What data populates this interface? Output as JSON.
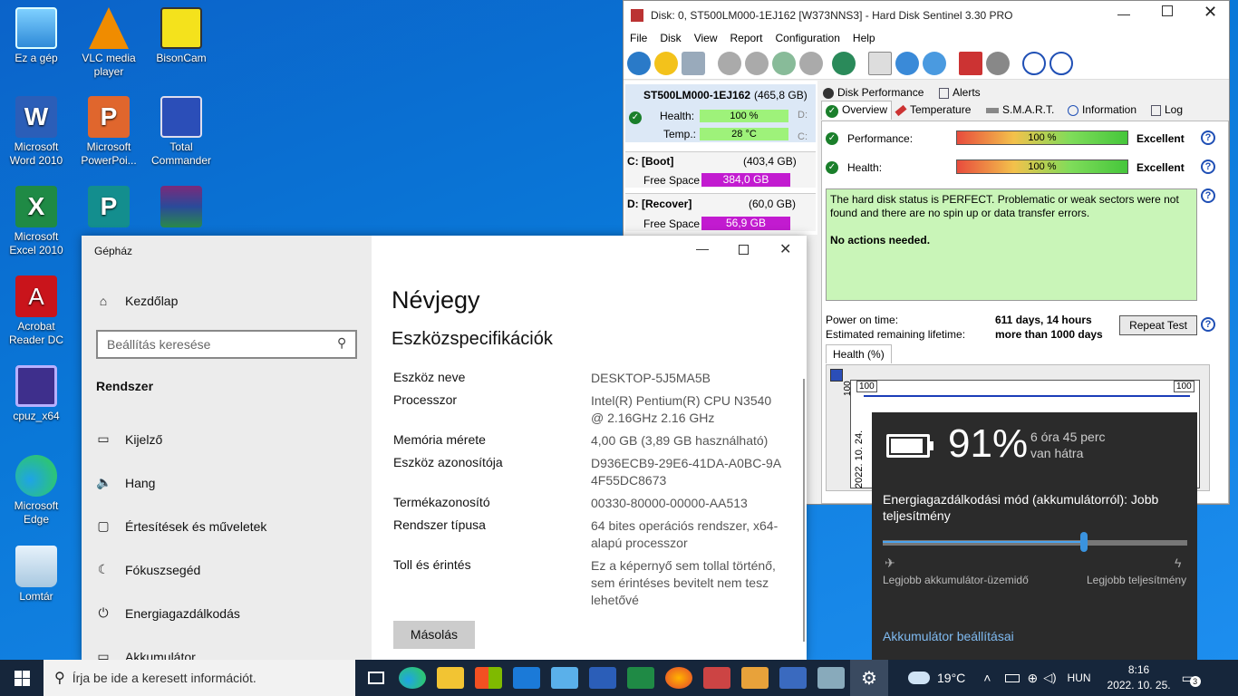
{
  "desktop": {
    "icons": [
      {
        "label": "Ez a gép",
        "icon": "computer-icon"
      },
      {
        "label": "VLC media player",
        "icon": "vlc-icon"
      },
      {
        "label": "BisonCam",
        "icon": "camera-icon"
      },
      {
        "label": "Microsoft Word 2010",
        "icon": "word-icon"
      },
      {
        "label": "Microsoft PowerPoi...",
        "icon": "powerpoint-icon"
      },
      {
        "label": "Total Commander",
        "icon": "floppy-icon"
      },
      {
        "label": "Microsoft Excel 2010",
        "icon": "excel-icon"
      },
      {
        "label": "Acrobat Reader DC",
        "icon": "acrobat-icon"
      },
      {
        "label": "cpuz_x64",
        "icon": "cpuz-icon"
      },
      {
        "label": "Microsoft Edge",
        "icon": "edge-icon"
      },
      {
        "label": "Lomtár",
        "icon": "recycle-bin-icon"
      }
    ]
  },
  "hds": {
    "title": "Disk: 0, ST500LM000-1EJ162 [W373NNS3]  -  Hard Disk Sentinel 3.30 PRO",
    "menu": [
      "File",
      "Disk",
      "View",
      "Report",
      "Configuration",
      "Help"
    ],
    "disk_name": "ST500LM000-1EJ162",
    "disk_size": "(465,8 GB)",
    "health_label": "Health:",
    "health_value": "100 %",
    "temp_label": "Temp.:",
    "temp_value": "28 °C",
    "drive_c_name": "C: [Boot]",
    "drive_c_size": "(403,4 GB)",
    "drive_c_free_label": "Free Space",
    "drive_c_free": "384,0 GB",
    "drive_d_name": "D: [Recover]",
    "drive_d_size": "(60,0 GB)",
    "drive_d_free_label": "Free Space",
    "drive_d_free": "56,9 GB",
    "tabs_top": [
      "Disk Performance",
      "Alerts"
    ],
    "tabs": [
      "Overview",
      "Temperature",
      "S.M.A.R.T.",
      "Information",
      "Log"
    ],
    "performance_label": "Performance:",
    "performance_value": "100 %",
    "performance_rating": "Excellent",
    "health2_label": "Health:",
    "health2_value": "100 %",
    "health2_rating": "Excellent",
    "status_text": "The hard disk status is PERFECT. Problematic or weak sectors were not found and there are no spin up or data transfer errors.",
    "status_action": "No actions needed.",
    "power_on_label": "Power on time:",
    "power_on_value": "611 days, 14 hours",
    "remaining_label": "Estimated remaining lifetime:",
    "remaining_value": "more than 1000 days",
    "repeat_test": "Repeat Test",
    "graph_tab": "Health (%)",
    "graph_left_value": "100",
    "graph_right_value": "100",
    "graph_y_label": "100",
    "graph_date": "2022. 10. 24."
  },
  "settings": {
    "title": "Gépház",
    "home": "Kezdőlap",
    "search_placeholder": "Beállítás keresése",
    "section": "Rendszer",
    "nav": [
      {
        "label": "Kijelző",
        "icon": "display-icon"
      },
      {
        "label": "Hang",
        "icon": "sound-icon"
      },
      {
        "label": "Értesítések és műveletek",
        "icon": "notification-icon"
      },
      {
        "label": "Fókuszsegéd",
        "icon": "focus-icon"
      },
      {
        "label": "Energiagazdálkodás",
        "icon": "power-icon"
      },
      {
        "label": "Akkumulátor",
        "icon": "battery-icon"
      }
    ],
    "heading": "Névjegy",
    "subheading": "Eszközspecifikációk",
    "specs": [
      {
        "k": "Eszköz neve",
        "v": "DESKTOP-5J5MA5B"
      },
      {
        "k": "Processzor",
        "v": "Intel(R) Pentium(R) CPU  N3540 @ 2.16GHz   2.16 GHz"
      },
      {
        "k": "Memória mérete",
        "v": "4,00 GB (3,89 GB használható)"
      },
      {
        "k": "Eszköz azonosítója",
        "v": "D936ECB9-29E6-41DA-A0BC-9A4F55DC8673"
      },
      {
        "k": "Termékazonosító",
        "v": "00330-80000-00000-AA513"
      },
      {
        "k": "Rendszer típusa",
        "v": "64 bites operációs rendszer, x64-alapú processzor"
      },
      {
        "k": "Toll és érintés",
        "v": "Ez a képernyő sem tollal történő, sem érintéses bevitelt nem tesz lehetővé"
      }
    ],
    "copy_button": "Másolás"
  },
  "battery": {
    "percent": "91%",
    "remaining_line1": "6 óra 45 perc",
    "remaining_line2": "van hátra",
    "mode_text": "Energiagazdálkodási mód (akkumulátorról): Jobb teljesítmény",
    "slider_level": 0.66,
    "left_label": "Legjobb akkumulátor-üzemidő",
    "right_label": "Legjobb teljesítmény",
    "settings_link": "Akkumulátor beállításai"
  },
  "taskbar": {
    "search_placeholder": "Írja be ide a keresett információt.",
    "weather": "19°C",
    "language": "HUN",
    "time": "8:16",
    "date": "2022. 10. 25.",
    "notifications": "3"
  }
}
